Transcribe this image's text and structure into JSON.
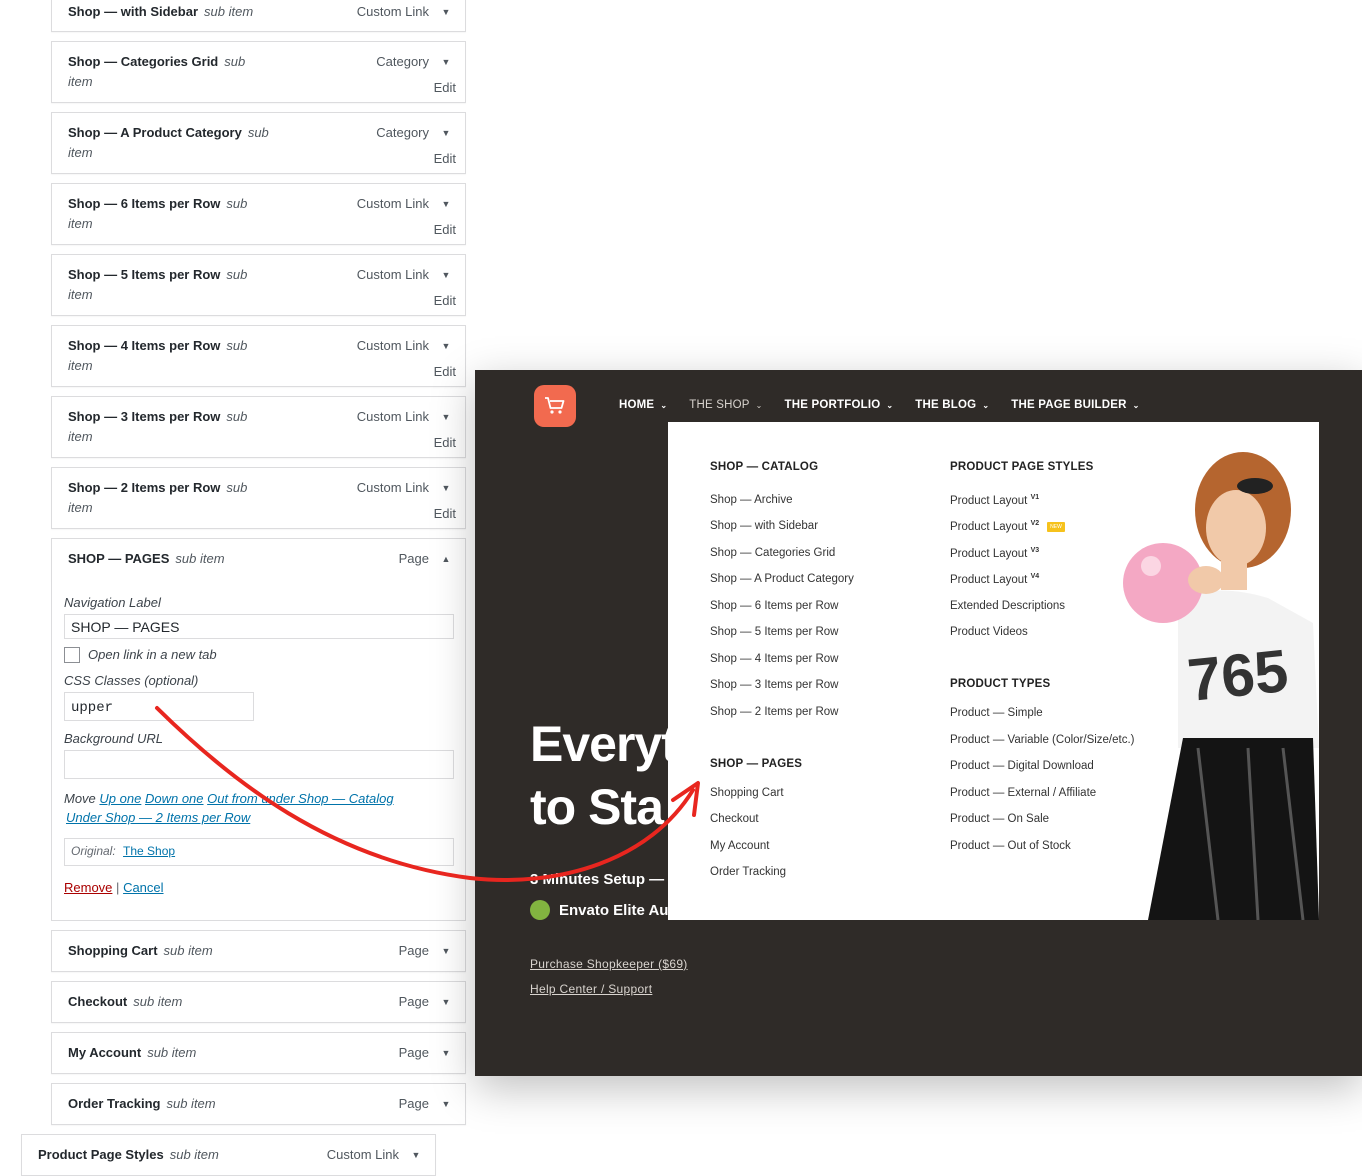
{
  "menu_items_top": [
    {
      "title": "Shop — with Sidebar",
      "sub": "sub item",
      "type": "Custom Link"
    },
    {
      "title": "Shop — Categories Grid",
      "sub": "sub",
      "sub2": "item",
      "type": "Category",
      "edit": "Edit"
    },
    {
      "title": "Shop — A Product Category",
      "sub": "sub",
      "sub2": "item",
      "type": "Category",
      "edit": "Edit"
    },
    {
      "title": "Shop — 6 Items per Row",
      "sub": "sub",
      "sub2": "item",
      "type": "Custom Link",
      "edit": "Edit"
    },
    {
      "title": "Shop — 5 Items per Row",
      "sub": "sub",
      "sub2": "item",
      "type": "Custom Link",
      "edit": "Edit"
    },
    {
      "title": "Shop — 4 Items per Row",
      "sub": "sub",
      "sub2": "item",
      "type": "Custom Link",
      "edit": "Edit"
    },
    {
      "title": "Shop — 3 Items per Row",
      "sub": "sub",
      "sub2": "item",
      "type": "Custom Link",
      "edit": "Edit"
    },
    {
      "title": "Shop — 2 Items per Row",
      "sub": "sub",
      "sub2": "item",
      "type": "Custom Link",
      "edit": "Edit"
    }
  ],
  "open_item": {
    "title": "SHOP — PAGES",
    "sub": "sub item",
    "type": "Page",
    "nav_label_label": "Navigation Label",
    "nav_label_value": "SHOP — PAGES",
    "new_tab_label": "Open link in a new tab",
    "css_label": "CSS Classes (optional)",
    "css_value": "upper",
    "bg_label": "Background URL",
    "bg_value": "",
    "move_label": "Move",
    "move_up": "Up one",
    "move_down": "Down one",
    "move_out": "Out from under Shop — Catalog",
    "move_under": "Under Shop — 2 Items per Row",
    "original_label": "Original:",
    "original_link": "The Shop",
    "remove": "Remove",
    "separator": "|",
    "cancel": "Cancel"
  },
  "menu_items_bottom": [
    {
      "title": "Shopping Cart",
      "sub": "sub item",
      "type": "Page"
    },
    {
      "title": "Checkout",
      "sub": "sub item",
      "type": "Page"
    },
    {
      "title": "My Account",
      "sub": "sub item",
      "type": "Page"
    },
    {
      "title": "Order Tracking",
      "sub": "sub item",
      "type": "Page"
    },
    {
      "title": "Product Page Styles",
      "sub": "sub item",
      "type": "Custom Link"
    }
  ],
  "site": {
    "nav": [
      {
        "label": "HOME"
      },
      {
        "label": "THE SHOP"
      },
      {
        "label": "THE PORTFOLIO"
      },
      {
        "label": "THE BLOG"
      },
      {
        "label": "THE PAGE BUILDER"
      }
    ],
    "hero_line1": "Everyt",
    "hero_line2": "to Sta",
    "setup": "3 Minutes Setup —",
    "envato": "Envato Elite Au",
    "purchase": "Purchase Shopkeeper ($69)",
    "help": "Help Center / Support",
    "mega": {
      "catalog_head": "SHOP — CATALOG",
      "catalog_items": [
        "Shop — Archive",
        "Shop — with Sidebar",
        "Shop — Categories Grid",
        "Shop — A Product Category",
        "Shop — 6 Items per Row",
        "Shop — 5 Items per Row",
        "Shop — 4 Items per Row",
        "Shop — 3 Items per Row",
        "Shop — 2 Items per Row"
      ],
      "pages_head": "SHOP — PAGES",
      "pages_items": [
        "Shopping Cart",
        "Checkout",
        "My Account",
        "Order Tracking"
      ],
      "styles_head": "PRODUCT PAGE STYLES",
      "styles_items": [
        {
          "label": "Product Layout",
          "sup": "V1"
        },
        {
          "label": "Product Layout",
          "sup": "V2",
          "badge": "NEW"
        },
        {
          "label": "Product Layout",
          "sup": "V3"
        },
        {
          "label": "Product Layout",
          "sup": "V4"
        },
        {
          "label": "Extended Descriptions"
        },
        {
          "label": "Product Videos"
        }
      ],
      "types_head": "PRODUCT TYPES",
      "types_items": [
        "Product — Simple",
        "Product — Variable (Color/Size/etc.)",
        "Product — Digital Download",
        "Product — External / Affiliate",
        "Product — On Sale",
        "Product — Out of Stock"
      ]
    }
  },
  "colors": {
    "accent": "#f26a4f",
    "arrow": "#e8261f",
    "link": "#0073aa",
    "remove": "#a00",
    "dark_bg": "#2f2b28"
  }
}
